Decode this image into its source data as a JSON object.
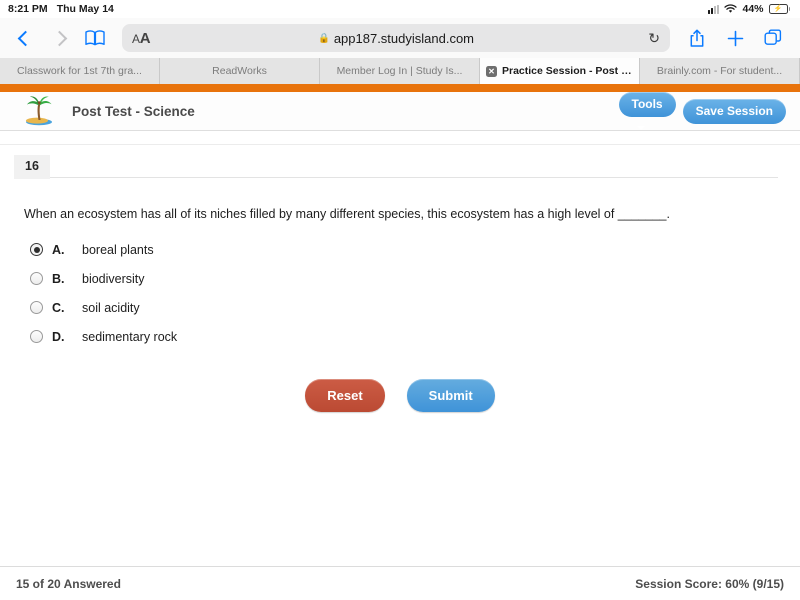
{
  "status_bar": {
    "time": "8:21 PM",
    "date": "Thu May 14",
    "battery_percent": "44%",
    "signal_icon": "cellular-signal-icon",
    "wifi_icon": "wifi-icon",
    "battery_icon": "battery-charging-icon"
  },
  "browser": {
    "back_icon": "chevron-left-icon",
    "forward_icon": "chevron-right-icon",
    "bookmarks_icon": "book-icon",
    "text_size_label": "A",
    "text_size_label_big": "A",
    "lock_icon": "lock-icon",
    "url": "app187.studyisland.com",
    "reload_icon": "reload-icon",
    "share_icon": "share-icon",
    "newtab_icon": "plus-icon",
    "tabs_icon": "tabs-overview-icon",
    "tabs": [
      {
        "label": "Classwork for 1st 7th gra...",
        "active": false
      },
      {
        "label": "ReadWorks",
        "active": false
      },
      {
        "label": "Member Log In | Study Is...",
        "active": false
      },
      {
        "label": "Practice Session - Post T...",
        "active": true,
        "close_label": "✕"
      },
      {
        "label": "Brainly.com - For student...",
        "active": false
      }
    ]
  },
  "app": {
    "brand_color": "#e8730c",
    "accent_blue": "#3f93d8",
    "logo_icon": "palm-tree-island-logo",
    "title": "Post Test - Science",
    "tools_label": "Tools",
    "save_session_label": "Save Session"
  },
  "question": {
    "number": "16",
    "text": "When an ecosystem has all of its niches filled by many different species, this ecosystem has a high level of _______.",
    "choices": [
      {
        "letter": "A.",
        "text": "boreal plants",
        "selected": true
      },
      {
        "letter": "B.",
        "text": "biodiversity",
        "selected": false
      },
      {
        "letter": "C.",
        "text": "soil acidity",
        "selected": false
      },
      {
        "letter": "D.",
        "text": "sedimentary rock",
        "selected": false
      }
    ],
    "reset_label": "Reset",
    "submit_label": "Submit"
  },
  "footer": {
    "answered": "15 of 20 Answered",
    "score": "Session Score: 60% (9/15)"
  }
}
